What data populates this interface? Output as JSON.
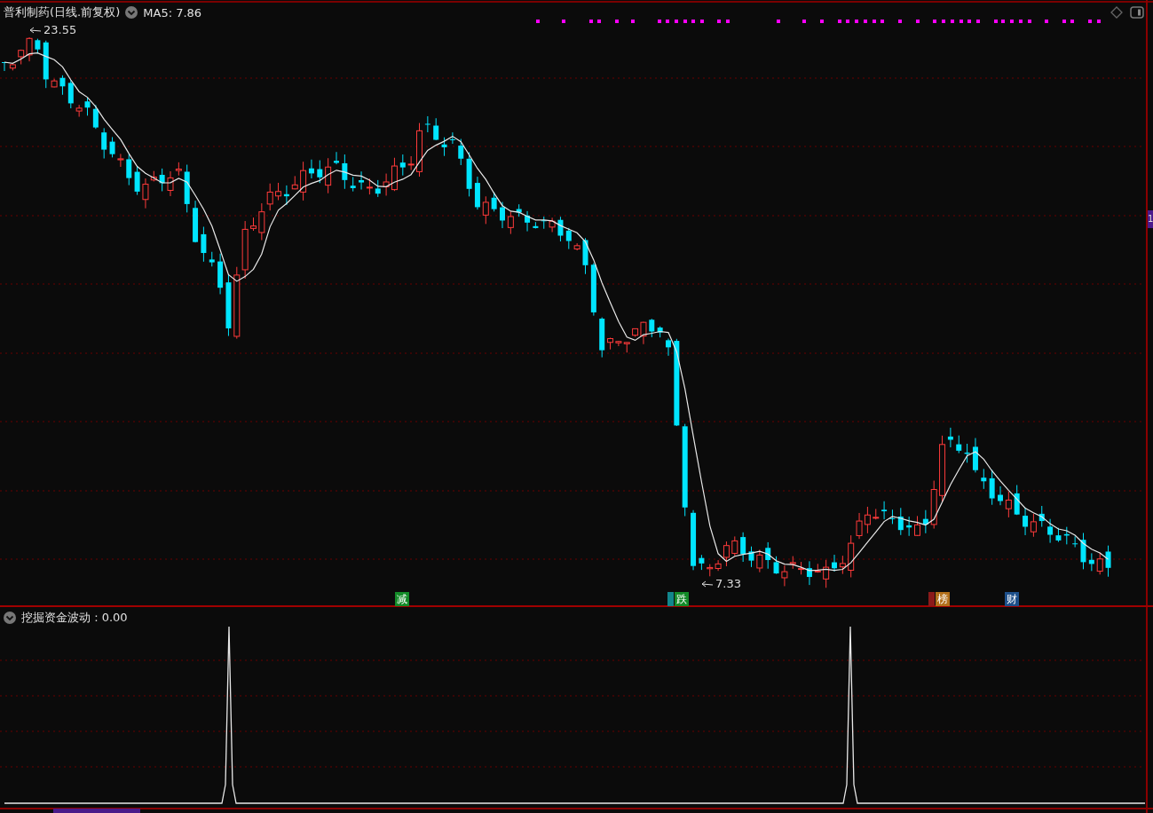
{
  "header": {
    "title": "普利制药(日线.前复权)",
    "indicator": "MA5: 7.86"
  },
  "price_labels": [
    {
      "kind": "high",
      "text": "23.55"
    },
    {
      "kind": "low",
      "text": "7.33"
    }
  ],
  "event_badges": [
    {
      "kind": "full",
      "text": "减",
      "color": "#138a28"
    },
    {
      "kind": "partial",
      "color": "#12868c"
    },
    {
      "kind": "full",
      "text": "跌",
      "color": "#138a28"
    },
    {
      "kind": "partial",
      "color": "#8b1a1a"
    },
    {
      "kind": "full",
      "text": "榜",
      "color": "#b3701a"
    },
    {
      "kind": "full",
      "text": "财",
      "color": "#1d4f8a"
    }
  ],
  "side_tag": {
    "text": "1"
  },
  "lower_pane": {
    "title": "挖掘资金波动 : 0.00"
  }
}
